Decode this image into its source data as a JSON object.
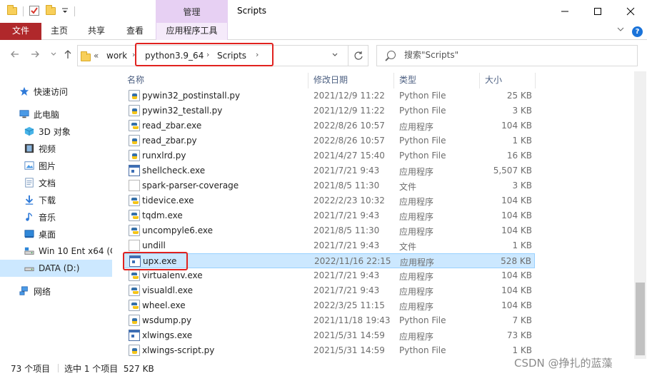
{
  "window": {
    "title": "Scripts",
    "manage_tab": "管理",
    "minimize_icon": "minimize-icon",
    "maximize_icon": "maximize-icon",
    "close_icon": "close-icon"
  },
  "ribbon": {
    "tabs": [
      "文件",
      "主页",
      "共享",
      "查看",
      "应用程序工具"
    ],
    "file_color": "#b0282b",
    "tools_color": "#e7d0f3"
  },
  "nav": {
    "back_icon": "back-arrow-icon",
    "forward_icon": "forward-arrow-icon",
    "recent_icon": "chevron-down-icon",
    "up_icon": "up-arrow-icon",
    "overflow": "«",
    "breadcrumbs": [
      "work",
      "python3.9_64",
      "Scripts"
    ],
    "refresh_icon": "refresh-icon"
  },
  "search": {
    "placeholder": "搜索\"Scripts\""
  },
  "sidebar": {
    "items": [
      {
        "label": "快速访问",
        "icon": "star-icon"
      },
      {
        "label": "此电脑",
        "icon": "computer-icon"
      },
      {
        "label": "3D 对象",
        "icon": "cube-icon"
      },
      {
        "label": "视频",
        "icon": "video-icon"
      },
      {
        "label": "图片",
        "icon": "picture-icon"
      },
      {
        "label": "文档",
        "icon": "document-icon"
      },
      {
        "label": "下载",
        "icon": "download-icon"
      },
      {
        "label": "音乐",
        "icon": "music-icon"
      },
      {
        "label": "桌面",
        "icon": "desktop-icon"
      },
      {
        "label": "Win 10 Ent x64 (C",
        "icon": "drive-icon"
      },
      {
        "label": "DATA (D:)",
        "icon": "drive-icon"
      },
      {
        "label": "网络",
        "icon": "network-icon"
      }
    ]
  },
  "columns": [
    "名称",
    "修改日期",
    "类型",
    "大小"
  ],
  "files": [
    {
      "name": "pywin32_postinstall.py",
      "date": "2021/12/9 11:22",
      "type": "Python File",
      "size": "25 KB",
      "icon": "py"
    },
    {
      "name": "pywin32_testall.py",
      "date": "2021/12/9 11:22",
      "type": "Python File",
      "size": "3 KB",
      "icon": "py"
    },
    {
      "name": "read_zbar.exe",
      "date": "2022/8/26 10:57",
      "type": "应用程序",
      "size": "104 KB",
      "icon": "exepy"
    },
    {
      "name": "read_zbar.py",
      "date": "2022/8/26 10:57",
      "type": "Python File",
      "size": "1 KB",
      "icon": "py"
    },
    {
      "name": "runxlrd.py",
      "date": "2021/4/27 15:40",
      "type": "Python File",
      "size": "16 KB",
      "icon": "py"
    },
    {
      "name": "shellcheck.exe",
      "date": "2021/7/21 9:43",
      "type": "应用程序",
      "size": "5,507 KB",
      "icon": "exe"
    },
    {
      "name": "spark-parser-coverage",
      "date": "2021/8/5 11:30",
      "type": "文件",
      "size": "3 KB",
      "icon": "file"
    },
    {
      "name": "tidevice.exe",
      "date": "2022/2/23 10:32",
      "type": "应用程序",
      "size": "104 KB",
      "icon": "exepy"
    },
    {
      "name": "tqdm.exe",
      "date": "2021/7/21 9:43",
      "type": "应用程序",
      "size": "104 KB",
      "icon": "exepy"
    },
    {
      "name": "uncompyle6.exe",
      "date": "2021/8/5 11:30",
      "type": "应用程序",
      "size": "104 KB",
      "icon": "exepy"
    },
    {
      "name": "undill",
      "date": "2021/7/21 9:43",
      "type": "文件",
      "size": "1 KB",
      "icon": "file"
    },
    {
      "name": "upx.exe",
      "date": "2022/11/16 22:15",
      "type": "应用程序",
      "size": "528 KB",
      "icon": "exe",
      "selected": true
    },
    {
      "name": "virtualenv.exe",
      "date": "2021/7/21 9:43",
      "type": "应用程序",
      "size": "104 KB",
      "icon": "exepy"
    },
    {
      "name": "visualdl.exe",
      "date": "2021/7/21 9:43",
      "type": "应用程序",
      "size": "104 KB",
      "icon": "exepy"
    },
    {
      "name": "wheel.exe",
      "date": "2022/3/25 11:15",
      "type": "应用程序",
      "size": "104 KB",
      "icon": "exepy"
    },
    {
      "name": "wsdump.py",
      "date": "2021/11/18 19:43",
      "type": "Python File",
      "size": "7 KB",
      "icon": "py"
    },
    {
      "name": "xlwings.exe",
      "date": "2021/5/31 14:59",
      "type": "应用程序",
      "size": "73 KB",
      "icon": "exe"
    },
    {
      "name": "xlwings-script.py",
      "date": "2021/5/31 14:59",
      "type": "Python File",
      "size": "1 KB",
      "icon": "py"
    }
  ],
  "status": {
    "count": "73 个项目",
    "selection": "选中 1 个项目  527 KB"
  },
  "watermark": "CSDN @挣扎的蓝藻",
  "highlight_color": "#e1221f"
}
